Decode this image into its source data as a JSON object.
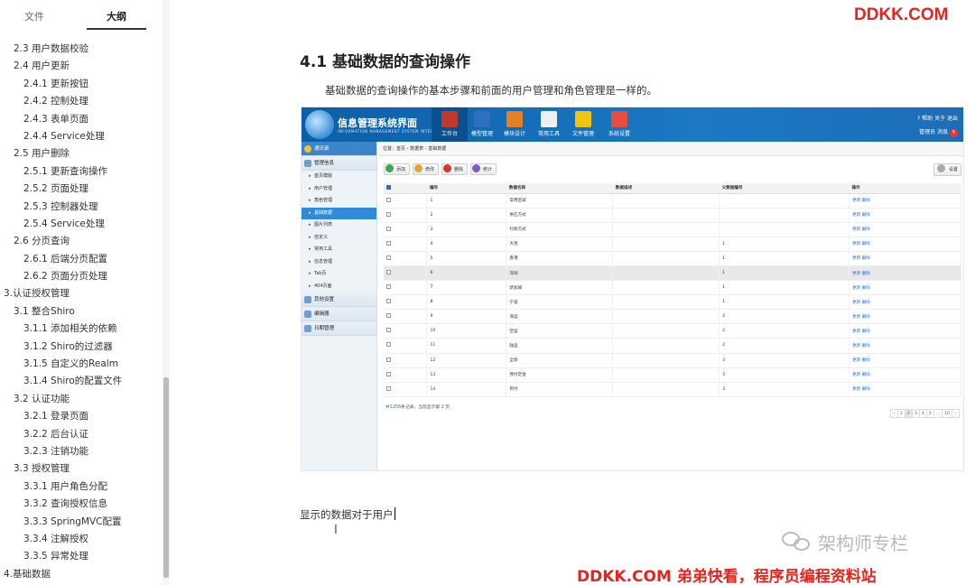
{
  "sidebar": {
    "tabs": [
      "文件",
      "大纲"
    ],
    "active_tab": "大纲",
    "outline": [
      {
        "label": "2.3 用户数据校验",
        "level": 1
      },
      {
        "label": "2.4 用户更新",
        "level": 1
      },
      {
        "label": "2.4.1 更新按钮",
        "level": 2
      },
      {
        "label": "2.4.2 控制处理",
        "level": 2
      },
      {
        "label": "2.4.3 表单页面",
        "level": 2
      },
      {
        "label": "2.4.4 Service处理",
        "level": 2
      },
      {
        "label": "2.5 用户删除",
        "level": 1
      },
      {
        "label": "2.5.1 更新查询操作",
        "level": 2
      },
      {
        "label": "2.5.2 页面处理",
        "level": 2
      },
      {
        "label": "2.5.3 控制器处理",
        "level": 2
      },
      {
        "label": "2.5.4 Service处理",
        "level": 2
      },
      {
        "label": "2.6 分页查询",
        "level": 1
      },
      {
        "label": "2.6.1 后端分页配置",
        "level": 2
      },
      {
        "label": "2.6.2 页面分页处理",
        "level": 2
      },
      {
        "label": "3.认证授权管理",
        "level": 0
      },
      {
        "label": "3.1 整合Shiro",
        "level": 1
      },
      {
        "label": "3.1.1 添加相关的依赖",
        "level": 2
      },
      {
        "label": "3.1.2 Shiro的过滤器",
        "level": 2
      },
      {
        "label": "3.1.5 自定义的Realm",
        "level": 2
      },
      {
        "label": "3.1.4 Shiro的配置文件",
        "level": 2
      },
      {
        "label": "3.2 认证功能",
        "level": 1
      },
      {
        "label": "3.2.1 登录页面",
        "level": 2
      },
      {
        "label": "3.2.2 后台认证",
        "level": 2
      },
      {
        "label": "3.2.3 注销功能",
        "level": 2
      },
      {
        "label": "3.3 授权管理",
        "level": 1
      },
      {
        "label": "3.3.1 用户角色分配",
        "level": 2
      },
      {
        "label": "3.3.2 查询授权信息",
        "level": 2
      },
      {
        "label": "3.3.3 SpringMVC配置",
        "level": 2
      },
      {
        "label": "3.3.4 注解授权",
        "level": 2
      },
      {
        "label": "3.3.5 异常处理",
        "level": 2
      },
      {
        "label": "4.基础数据",
        "level": 0
      }
    ]
  },
  "document": {
    "heading": "4.1 基础数据的查询操作",
    "paragraph": "基础数据的查询操作的基本步骤和前面的用户管理和角色管理是一样的。",
    "bottom_text": "显示的数据对于用户"
  },
  "watermarks": {
    "top": "DDKK.COM",
    "bottom": "DDKK.COM 弟弟快看，程序员编程资料站",
    "wechat": "架构师专栏"
  },
  "screenshot": {
    "system_title": "信息管理系统界面",
    "system_subtitle": "INFORMATION MANAGEMENT SYSTEM INTERFACE",
    "nav": [
      {
        "label": "工作台",
        "icon": "book-icon",
        "color": "#c0392b"
      },
      {
        "label": "模型管理",
        "icon": "pencil-icon",
        "color": "#2e6fbf"
      },
      {
        "label": "模块设计",
        "icon": "network-icon",
        "color": "#e67e22"
      },
      {
        "label": "常用工具",
        "icon": "printer-icon",
        "color": "#ecf0f1"
      },
      {
        "label": "文件管理",
        "icon": "folder-icon",
        "color": "#f1c40f"
      },
      {
        "label": "系统设置",
        "icon": "tools-icon",
        "color": "#e74c3c"
      }
    ],
    "top_links": "? 帮助  关于  退出",
    "user_line": "管理员  消息",
    "badge": "5",
    "left_sections": [
      {
        "label": "通讯录"
      },
      {
        "label": "管理信息"
      }
    ],
    "left_items": [
      "首页模版",
      "用户管理",
      "角色管理",
      "基础数据",
      "图片列表",
      "自定义",
      "常用工具",
      "信息管理",
      "Tab页",
      "404页面"
    ],
    "left_bottom_sections": [
      "其他设置",
      "编辑器",
      "日期管理"
    ],
    "breadcrumb": "位置：首页 › 数据表 › 基础数据",
    "toolbar": [
      "添加",
      "修改",
      "删除",
      "统计"
    ],
    "settings_label": "设置",
    "columns": [
      "",
      "编号",
      "数据名称",
      "数据描述",
      "父数据编号",
      "操作"
    ],
    "rows": [
      {
        "id": "1",
        "name": "常用区域",
        "desc": "",
        "parent": "",
        "ops": "更新 删除"
      },
      {
        "id": "2",
        "name": "供应方式",
        "desc": "",
        "parent": "",
        "ops": "更新 删除"
      },
      {
        "id": "3",
        "name": "付款方式",
        "desc": "",
        "parent": "",
        "ops": "更新 删除"
      },
      {
        "id": "4",
        "name": "大连",
        "desc": "",
        "parent": "1",
        "ops": "更新 删除"
      },
      {
        "id": "5",
        "name": "香港",
        "desc": "",
        "parent": "1",
        "ops": "更新 删除"
      },
      {
        "id": "6",
        "name": "深圳",
        "desc": "",
        "parent": "1",
        "ops": "更新 删除"
      },
      {
        "id": "7",
        "name": "新加坡",
        "desc": "",
        "parent": "1",
        "ops": "更新 删除"
      },
      {
        "id": "8",
        "name": "宁波",
        "desc": "",
        "parent": "1",
        "ops": "更新 删除"
      },
      {
        "id": "9",
        "name": "海运",
        "desc": "",
        "parent": "2",
        "ops": "更新 删除"
      },
      {
        "id": "10",
        "name": "空运",
        "desc": "",
        "parent": "2",
        "ops": "更新 删除"
      },
      {
        "id": "11",
        "name": "陆运",
        "desc": "",
        "parent": "2",
        "ops": "更新 删除"
      },
      {
        "id": "12",
        "name": "全款",
        "desc": "",
        "parent": "3",
        "ops": "更新 删除"
      },
      {
        "id": "13",
        "name": "预付定金",
        "desc": "",
        "parent": "3",
        "ops": "更新 删除"
      },
      {
        "id": "14",
        "name": "到付",
        "desc": "",
        "parent": "3",
        "ops": "更新 删除"
      }
    ],
    "selected_row": "6",
    "footer_prefix": "共",
    "footer_count": "1256",
    "footer_suffix": "条记录，当前显示第 2 页",
    "pages": [
      "‹",
      "1",
      "2",
      "3",
      "4",
      "5",
      "...",
      "10",
      "›"
    ],
    "current_page": "2"
  }
}
